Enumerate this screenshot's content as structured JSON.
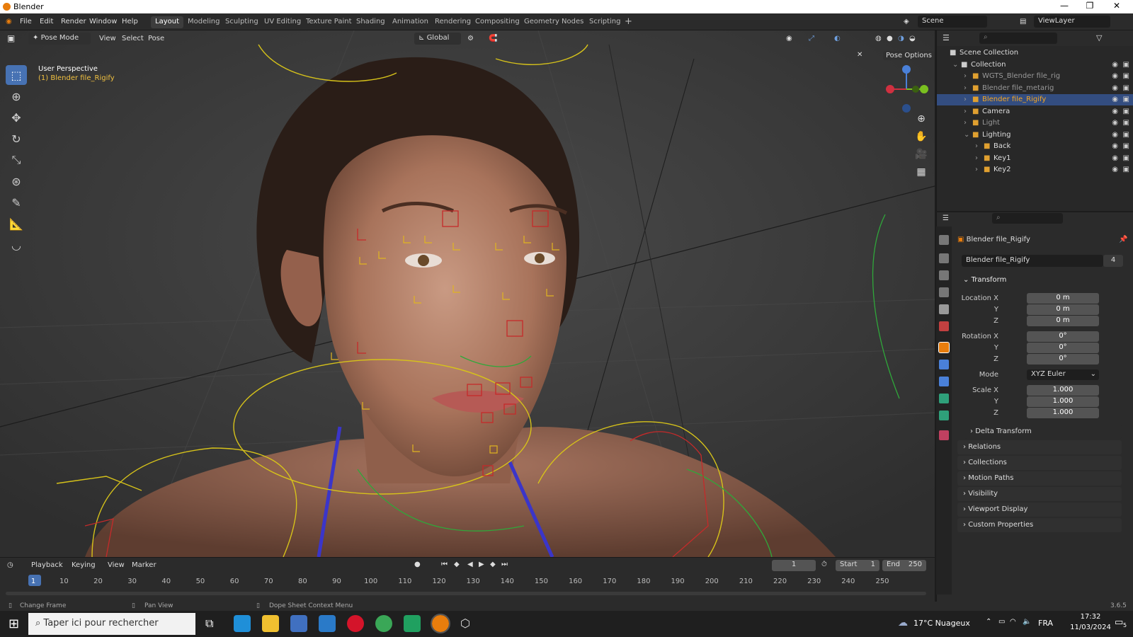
{
  "window": {
    "title": "Blender"
  },
  "menu": [
    "File",
    "Edit",
    "Render",
    "Window",
    "Help"
  ],
  "workspaces": [
    "Layout",
    "Modeling",
    "Sculpting",
    "UV Editing",
    "Texture Paint",
    "Shading",
    "Animation",
    "Rendering",
    "Compositing",
    "Geometry Nodes",
    "Scripting"
  ],
  "active_workspace": "Layout",
  "scene": {
    "name": "Scene",
    "view_layer": "ViewLayer"
  },
  "viewport": {
    "mode": "Pose Mode",
    "menus": [
      "View",
      "Select",
      "Pose"
    ],
    "orientation": "Global",
    "pose_options": "Pose Options",
    "perspective": "User Perspective",
    "active_object": "(1) Blender file_Rigify"
  },
  "outliner": {
    "rows": [
      {
        "label": "Scene Collection",
        "indent": 0
      },
      {
        "label": "Collection",
        "indent": 1
      },
      {
        "label": "WGTS_Blender file_rig",
        "indent": 2
      },
      {
        "label": "Blender file_metarig",
        "indent": 2
      },
      {
        "label": "Blender file_Rigify",
        "indent": 2,
        "selected": true
      },
      {
        "label": "Camera",
        "indent": 2
      },
      {
        "label": "Light",
        "indent": 2
      },
      {
        "label": "Lighting",
        "indent": 2
      },
      {
        "label": "Back",
        "indent": 3
      },
      {
        "label": "Key1",
        "indent": 3
      },
      {
        "label": "Key2",
        "indent": 3
      }
    ]
  },
  "properties": {
    "object_name": "Blender file_Rigify",
    "datablock_name": "Blender file_Rigify",
    "users": "4",
    "transform_label": "Transform",
    "location": {
      "label_x": "Location X",
      "x": "0 m",
      "y": "0 m",
      "z": "0 m"
    },
    "rotation": {
      "label_x": "Rotation X",
      "x": "0°",
      "y": "0°",
      "z": "0°"
    },
    "mode_label": "Mode",
    "mode": "XYZ Euler",
    "scale": {
      "label_x": "Scale X",
      "x": "1.000",
      "y": "1.000",
      "z": "1.000"
    },
    "axis_y": "Y",
    "axis_z": "Z",
    "sections": [
      "Delta Transform",
      "Relations",
      "Collections",
      "Motion Paths",
      "Visibility",
      "Viewport Display",
      "Custom Properties"
    ]
  },
  "timeline": {
    "menus": [
      "Playback",
      "Keying",
      "View",
      "Marker"
    ],
    "current_frame": "1",
    "start_label": "Start",
    "start": "1",
    "end_label": "End",
    "end": "250",
    "ticks": [
      "1",
      "10",
      "20",
      "30",
      "40",
      "50",
      "60",
      "70",
      "80",
      "90",
      "100",
      "110",
      "120",
      "130",
      "140",
      "150",
      "160",
      "170",
      "180",
      "190",
      "200",
      "210",
      "220",
      "230",
      "240",
      "250"
    ]
  },
  "status": {
    "left": "Change Frame",
    "middle": "Pan View",
    "right": "Dope Sheet Context Menu",
    "version": "3.6.5"
  },
  "taskbar": {
    "search_placeholder": "Taper ici pour rechercher",
    "weather": "17°C Nuageux",
    "lang": "FRA",
    "time": "17:32",
    "date": "11/03/2024",
    "notif_count": "5"
  },
  "colors": {
    "accent": "#4772b3",
    "selection": "#334d80",
    "blender_orange": "#e87d0d"
  }
}
